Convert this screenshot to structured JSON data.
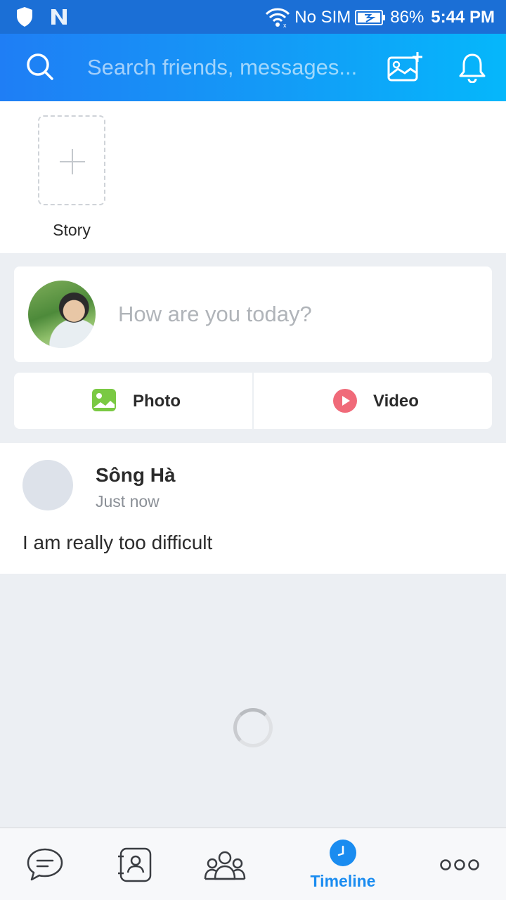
{
  "status_bar": {
    "carrier": "No SIM",
    "battery": "86%",
    "time": "5:44 PM",
    "icons": [
      "shield-icon",
      "n-notification-icon",
      "wifi-icon",
      "battery-icon"
    ]
  },
  "header": {
    "search_placeholder": "Search friends, messages...",
    "icons": [
      "search-icon",
      "add-photo-icon",
      "bell-icon"
    ]
  },
  "story": {
    "label": "Story"
  },
  "composer": {
    "prompt": "How are you today?"
  },
  "actions": {
    "photo_label": "Photo",
    "video_label": "Video"
  },
  "post": {
    "author": "Sông Hà",
    "time": "Just now",
    "text": "I am really too difficult"
  },
  "bottom_nav": {
    "items": [
      {
        "icon": "chat-icon",
        "label": ""
      },
      {
        "icon": "contacts-icon",
        "label": ""
      },
      {
        "icon": "groups-icon",
        "label": ""
      },
      {
        "icon": "timeline-icon",
        "label": "Timeline",
        "active": true
      },
      {
        "icon": "more-icon",
        "label": ""
      }
    ]
  },
  "colors": {
    "accent": "#1a8cf0",
    "header_start": "#1f7ef5",
    "header_end": "#05b7fb",
    "photo_green": "#7ac943",
    "video_red": "#f06a79"
  }
}
